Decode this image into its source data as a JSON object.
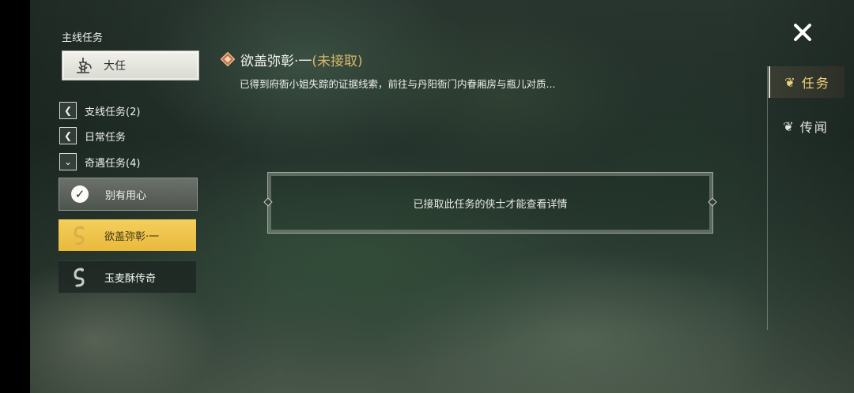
{
  "left_panel": {
    "section_title": "主线任务",
    "main_quest": {
      "label": "大任",
      "icon": "hookah-icon"
    },
    "categories": [
      {
        "label": "支线任务(2)",
        "state": "collapsed"
      },
      {
        "label": "日常任务",
        "state": "collapsed"
      },
      {
        "label": "奇遇任务(4)",
        "state": "expanded"
      }
    ],
    "quests": [
      {
        "label": "别有用心",
        "icon": "check-icon",
        "status": "completed"
      },
      {
        "label": "欲盖弥彰·一",
        "icon": "serpent-icon",
        "status": "selected"
      },
      {
        "label": "玉麦酥传奇",
        "icon": "serpent-icon",
        "status": "normal"
      }
    ]
  },
  "detail": {
    "title": "欲盖弥彰·一",
    "status": "(未接取)",
    "description": "已得到府衙小姐失踪的证据线索，前往与丹阳衙门内眷厢房与瓶儿对质...",
    "notice": "已接取此任务的侠士才能查看详情"
  },
  "tabs": [
    {
      "label": "任务",
      "active": true
    },
    {
      "label": "传闻",
      "active": false
    }
  ],
  "colors": {
    "accent_gold": "#f4cf5c",
    "tab_active_text": "#f3d37c",
    "status_text": "#d9b86a"
  }
}
